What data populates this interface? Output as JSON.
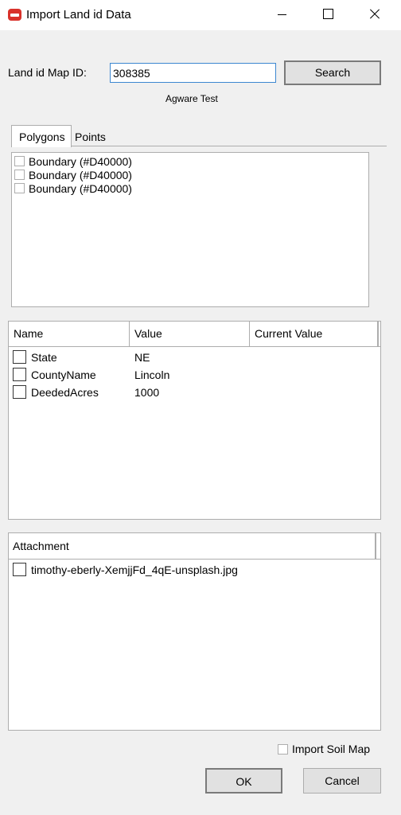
{
  "window": {
    "title": "Import Land id Data",
    "icon": "app-logo-icon",
    "accent": "#d9322b"
  },
  "form": {
    "map_id_label": "Land id Map ID:",
    "map_id_value": "308385",
    "search_label": "Search",
    "account_name": "Agware Test"
  },
  "tabs": [
    {
      "label": "Polygons",
      "active": true
    },
    {
      "label": "Points",
      "active": false
    }
  ],
  "polygons": [
    {
      "label": "Boundary (#D40000)",
      "checked": false
    },
    {
      "label": "Boundary (#D40000)",
      "checked": false
    },
    {
      "label": "Boundary (#D40000)",
      "checked": false
    }
  ],
  "attributes": {
    "columns": [
      "Name",
      "Value",
      "Current Value"
    ],
    "rows": [
      {
        "name": "State",
        "value": "NE",
        "current": "",
        "checked": false
      },
      {
        "name": "CountyName",
        "value": "Lincoln",
        "current": "",
        "checked": false
      },
      {
        "name": "DeededAcres",
        "value": "1000",
        "current": "",
        "checked": false
      }
    ]
  },
  "attachments": {
    "column": "Attachment",
    "rows": [
      {
        "name": "timothy-eberly-XemjjFd_4qE-unsplash.jpg",
        "checked": false
      }
    ]
  },
  "footer": {
    "import_soil_label": "Import Soil Map",
    "import_soil_checked": false,
    "ok_label": "OK",
    "cancel_label": "Cancel"
  }
}
